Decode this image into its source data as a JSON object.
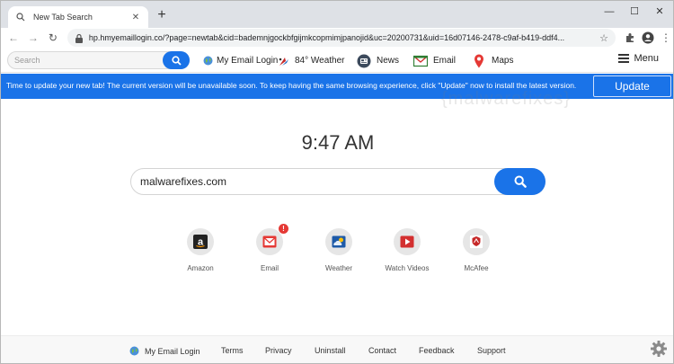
{
  "browser": {
    "tab_title": "New Tab Search",
    "url": "hp.hmyemaillogin.co/?page=newtab&cid=bademnjgockbfgijmkcopmimjpanojid&uc=20200731&uid=16d07146-2478-c9af-b419-ddf4..."
  },
  "toolbar": {
    "search_placeholder": "Search",
    "links": [
      {
        "label": "My Email Login",
        "icon": "globe-icon"
      },
      {
        "label": "84° Weather",
        "icon": "weather-icon"
      },
      {
        "label": "News",
        "icon": "news-icon"
      },
      {
        "label": "Email",
        "icon": "email-icon"
      },
      {
        "label": "Maps",
        "icon": "map-pin-icon"
      }
    ],
    "menu_label": "Menu"
  },
  "banner": {
    "text": "Time to update your new tab! The current version will be unavailable soon. To keep having the same browsing experience, click \"Update\" now to install the latest version.",
    "button_label": "Update"
  },
  "watermark": "{malwarefixes}",
  "main": {
    "time": "9:47 AM",
    "search_value": "malwarefixes.com",
    "tiles": [
      {
        "label": "Amazon",
        "icon": "amazon-icon"
      },
      {
        "label": "Email",
        "icon": "email-icon",
        "badge": "!"
      },
      {
        "label": "Weather",
        "icon": "weather-icon"
      },
      {
        "label": "Watch Videos",
        "icon": "video-icon"
      },
      {
        "label": "McAfee",
        "icon": "mcafee-icon"
      }
    ]
  },
  "footer": {
    "links": [
      "My Email Login",
      "Terms",
      "Privacy",
      "Uninstall",
      "Contact",
      "Feedback",
      "Support"
    ]
  },
  "colors": {
    "accent": "#1a73e8",
    "banner_bg": "#1a73e8",
    "chrome_bg": "#dee1e6"
  }
}
